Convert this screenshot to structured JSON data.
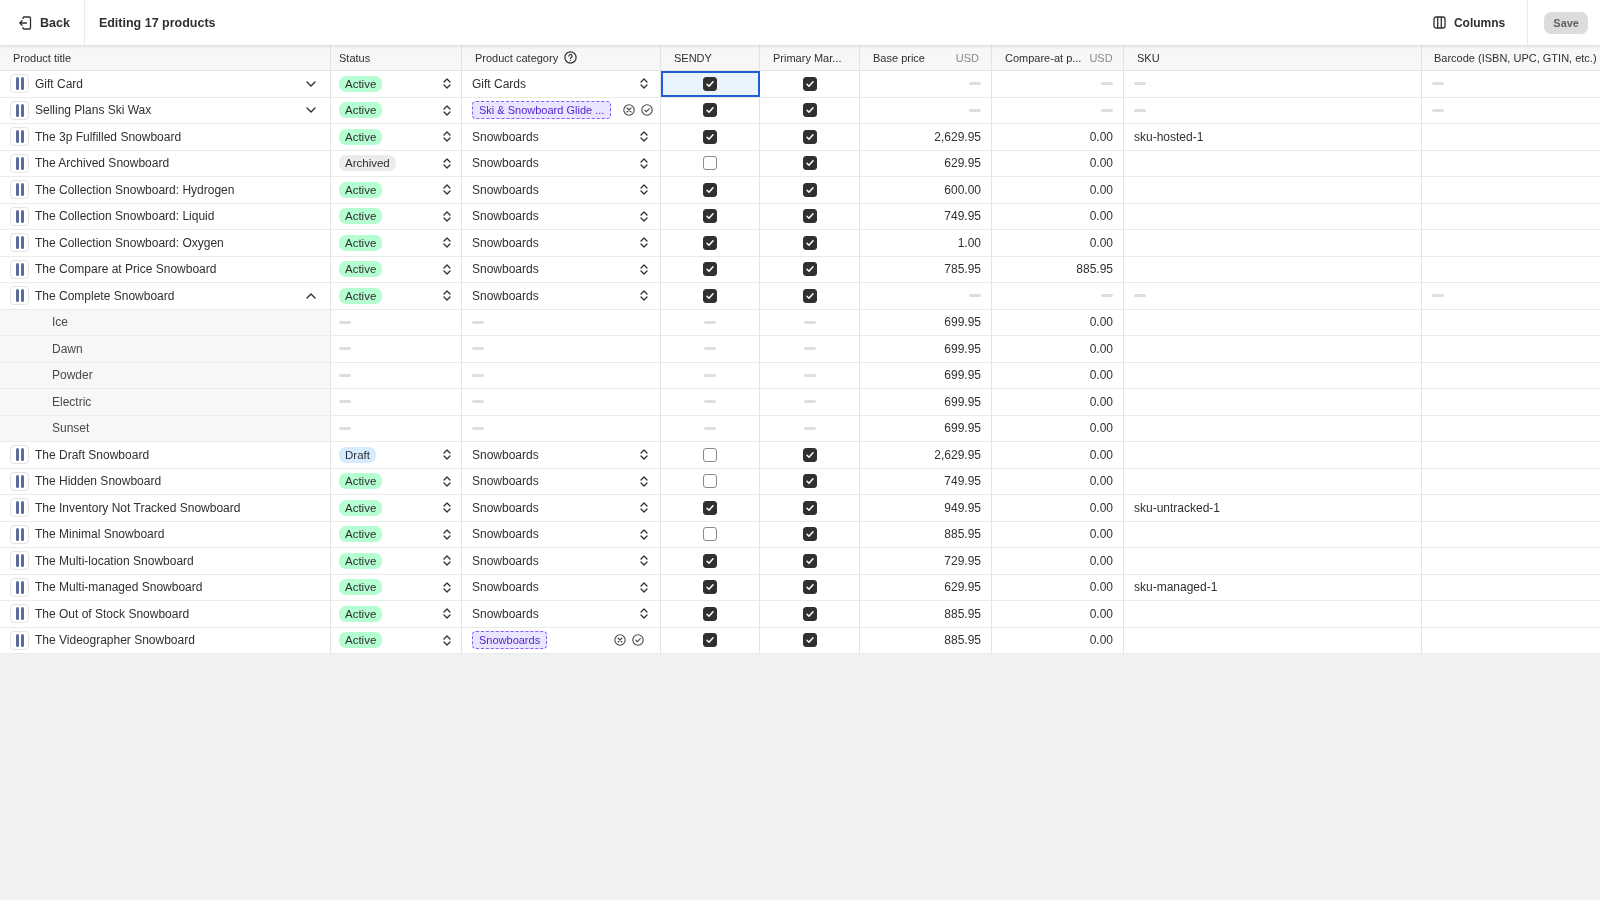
{
  "header": {
    "back": "Back",
    "title": "Editing 17 products",
    "columns_button": "Columns",
    "save_button": {
      "label": "Save",
      "disabled": true
    }
  },
  "columns": [
    {
      "label": "Product title"
    },
    {
      "label": "Status"
    },
    {
      "label": "Product category",
      "help": true
    },
    {
      "label": "SENDY"
    },
    {
      "label": "Primary Mar..."
    },
    {
      "label": "Base price",
      "unit": "USD"
    },
    {
      "label": "Compare-at p...",
      "unit": "USD"
    },
    {
      "label": "SKU"
    },
    {
      "label": "Barcode (ISBN, UPC, GTIN, etc.)"
    }
  ],
  "rows": [
    {
      "kind": "product",
      "title": "Gift Card",
      "has_variants": true,
      "expanded": false,
      "status": {
        "label": "Active",
        "color": "#b4fed2"
      },
      "category": {
        "value": "Gift Cards",
        "edited": false
      },
      "sendy": {
        "checked": true,
        "selected": true
      },
      "primary": {
        "checked": true
      }
    },
    {
      "kind": "product",
      "title": "Selling Plans Ski Wax",
      "has_variants": true,
      "expanded": false,
      "status": {
        "label": "Active",
        "color": "#b4fed2"
      },
      "category": {
        "value": "Ski & Snowboard Glide ...",
        "edited": true
      },
      "sendy": {
        "checked": true,
        "selected": false
      },
      "primary": {
        "checked": true
      }
    },
    {
      "kind": "product",
      "title": "The 3p Fulfilled Snowboard",
      "has_variants": false,
      "status": {
        "label": "Active",
        "color": "#b4fed2"
      },
      "category": {
        "value": "Snowboards",
        "edited": false
      },
      "sendy": {
        "checked": true,
        "selected": false
      },
      "primary": {
        "checked": true
      },
      "base_price": "2,629.95",
      "compare_price": "0.00",
      "sku": "sku-hosted-1"
    },
    {
      "kind": "product",
      "title": "The Archived Snowboard",
      "has_variants": false,
      "status": {
        "label": "Archived",
        "color": "#ebebeb"
      },
      "category": {
        "value": "Snowboards",
        "edited": false
      },
      "sendy": {
        "checked": false,
        "selected": false
      },
      "primary": {
        "checked": true
      },
      "base_price": "629.95",
      "compare_price": "0.00"
    },
    {
      "kind": "product",
      "title": "The Collection Snowboard: Hydrogen",
      "has_variants": false,
      "status": {
        "label": "Active",
        "color": "#b4fed2"
      },
      "category": {
        "value": "Snowboards",
        "edited": false
      },
      "sendy": {
        "checked": true,
        "selected": false
      },
      "primary": {
        "checked": true
      },
      "base_price": "600.00",
      "compare_price": "0.00"
    },
    {
      "kind": "product",
      "title": "The Collection Snowboard: Liquid",
      "has_variants": false,
      "status": {
        "label": "Active",
        "color": "#b4fed2"
      },
      "category": {
        "value": "Snowboards",
        "edited": false
      },
      "sendy": {
        "checked": true,
        "selected": false
      },
      "primary": {
        "checked": true
      },
      "base_price": "749.95",
      "compare_price": "0.00"
    },
    {
      "kind": "product",
      "title": "The Collection Snowboard: Oxygen",
      "has_variants": false,
      "status": {
        "label": "Active",
        "color": "#b4fed2"
      },
      "category": {
        "value": "Snowboards",
        "edited": false
      },
      "sendy": {
        "checked": true,
        "selected": false
      },
      "primary": {
        "checked": true
      },
      "base_price": "1.00",
      "compare_price": "0.00"
    },
    {
      "kind": "product",
      "title": "The Compare at Price Snowboard",
      "has_variants": false,
      "status": {
        "label": "Active",
        "color": "#b4fed2"
      },
      "category": {
        "value": "Snowboards",
        "edited": false
      },
      "sendy": {
        "checked": true,
        "selected": false
      },
      "primary": {
        "checked": true
      },
      "base_price": "785.95",
      "compare_price": "885.95"
    },
    {
      "kind": "product",
      "title": "The Complete Snowboard",
      "has_variants": true,
      "expanded": true,
      "status": {
        "label": "Active",
        "color": "#b4fed2"
      },
      "category": {
        "value": "Snowboards",
        "edited": false
      },
      "sendy": {
        "checked": true,
        "selected": false
      },
      "primary": {
        "checked": true
      }
    },
    {
      "kind": "variant",
      "title": "Ice",
      "base_price": "699.95",
      "compare_price": "0.00"
    },
    {
      "kind": "variant",
      "title": "Dawn",
      "base_price": "699.95",
      "compare_price": "0.00"
    },
    {
      "kind": "variant",
      "title": "Powder",
      "base_price": "699.95",
      "compare_price": "0.00"
    },
    {
      "kind": "variant",
      "title": "Electric",
      "base_price": "699.95",
      "compare_price": "0.00"
    },
    {
      "kind": "variant",
      "title": "Sunset",
      "base_price": "699.95",
      "compare_price": "0.00"
    },
    {
      "kind": "product",
      "title": "The Draft Snowboard",
      "has_variants": false,
      "status": {
        "label": "Draft",
        "color": "#d5ebff"
      },
      "category": {
        "value": "Snowboards",
        "edited": false
      },
      "sendy": {
        "checked": false,
        "selected": false
      },
      "primary": {
        "checked": true
      },
      "base_price": "2,629.95",
      "compare_price": "0.00"
    },
    {
      "kind": "product",
      "title": "The Hidden Snowboard",
      "has_variants": false,
      "status": {
        "label": "Active",
        "color": "#b4fed2"
      },
      "category": {
        "value": "Snowboards",
        "edited": false
      },
      "sendy": {
        "checked": false,
        "selected": false
      },
      "primary": {
        "checked": true
      },
      "base_price": "749.95",
      "compare_price": "0.00"
    },
    {
      "kind": "product",
      "title": "The Inventory Not Tracked Snowboard",
      "has_variants": false,
      "status": {
        "label": "Active",
        "color": "#b4fed2"
      },
      "category": {
        "value": "Snowboards",
        "edited": false
      },
      "sendy": {
        "checked": true,
        "selected": false
      },
      "primary": {
        "checked": true
      },
      "base_price": "949.95",
      "compare_price": "0.00",
      "sku": "sku-untracked-1"
    },
    {
      "kind": "product",
      "title": "The Minimal Snowboard",
      "has_variants": false,
      "status": {
        "label": "Active",
        "color": "#b4fed2"
      },
      "category": {
        "value": "Snowboards",
        "edited": false
      },
      "sendy": {
        "checked": false,
        "selected": false
      },
      "primary": {
        "checked": true
      },
      "base_price": "885.95",
      "compare_price": "0.00"
    },
    {
      "kind": "product",
      "title": "The Multi-location Snowboard",
      "has_variants": false,
      "status": {
        "label": "Active",
        "color": "#b4fed2"
      },
      "category": {
        "value": "Snowboards",
        "edited": false
      },
      "sendy": {
        "checked": true,
        "selected": false
      },
      "primary": {
        "checked": true
      },
      "base_price": "729.95",
      "compare_price": "0.00"
    },
    {
      "kind": "product",
      "title": "The Multi-managed Snowboard",
      "has_variants": false,
      "status": {
        "label": "Active",
        "color": "#b4fed2"
      },
      "category": {
        "value": "Snowboards",
        "edited": false
      },
      "sendy": {
        "checked": true,
        "selected": false
      },
      "primary": {
        "checked": true
      },
      "base_price": "629.95",
      "compare_price": "0.00",
      "sku": "sku-managed-1"
    },
    {
      "kind": "product",
      "title": "The Out of Stock Snowboard",
      "has_variants": false,
      "status": {
        "label": "Active",
        "color": "#b4fed2"
      },
      "category": {
        "value": "Snowboards",
        "edited": false
      },
      "sendy": {
        "checked": true,
        "selected": false
      },
      "primary": {
        "checked": true
      },
      "base_price": "885.95",
      "compare_price": "0.00"
    },
    {
      "kind": "product",
      "title": "The Videographer Snowboard",
      "has_variants": false,
      "status": {
        "label": "Active",
        "color": "#b4fed2"
      },
      "category": {
        "value": "Snowboards",
        "edited": true
      },
      "sendy": {
        "checked": true,
        "selected": false
      },
      "primary": {
        "checked": true
      },
      "base_price": "885.95",
      "compare_price": "0.00"
    }
  ]
}
